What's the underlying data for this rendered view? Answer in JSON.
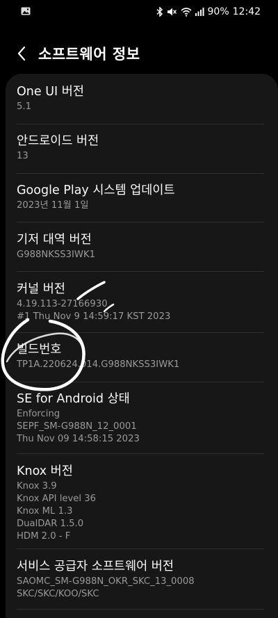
{
  "status_bar": {
    "battery": "90%",
    "time": "12:42",
    "icons": [
      "image-icon",
      "bluetooth-icon",
      "mute-icon",
      "wifi-icon",
      "signal-icon"
    ]
  },
  "header": {
    "title": "소프트웨어 정보",
    "back_icon": "chevron-left-icon"
  },
  "items": [
    {
      "title": "One UI 버전",
      "values": [
        "5.1"
      ]
    },
    {
      "title": "안드로이드 버전",
      "values": [
        "13"
      ]
    },
    {
      "title": "Google Play 시스템 업데이트",
      "values": [
        "2023년 11월 1일"
      ]
    },
    {
      "title": "기저 대역 버전",
      "values": [
        "G988NKSS3IWK1"
      ]
    },
    {
      "title": "커널 버전",
      "values": [
        "4.19.113-27166930",
        "#1 Thu Nov 9 14:59:17 KST 2023"
      ]
    },
    {
      "title": "빌드번호",
      "values": [
        "TP1A.220624.014.G988NKSS3IWK1"
      ]
    },
    {
      "title": "SE for Android 상태",
      "values": [
        "Enforcing",
        "SEPF_SM-G988N_12_0001",
        "Thu Nov 09 14:58:15 2023"
      ]
    },
    {
      "title": "Knox 버전",
      "values": [
        "Knox 3.9",
        "Knox API level 36",
        "Knox ML 1.3",
        "DualDAR 1.5.0",
        "HDM 2.0 - F"
      ]
    },
    {
      "title": "서비스 공급자 소프트웨어 버전",
      "values": [
        "SAOMC_SM-G988N_OKR_SKC_13_0008",
        "SKC/SKC/KOO/SKC"
      ]
    }
  ],
  "colors": {
    "background": "#000000",
    "card": "#171717",
    "title_text": "#fafafa",
    "value_text": "#9a9a9a",
    "divider": "#2f2f2f",
    "annotation": "#ffffff"
  }
}
